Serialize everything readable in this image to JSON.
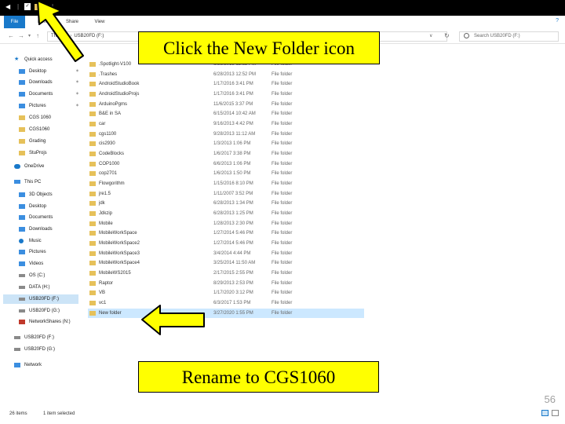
{
  "title_bar": {
    "quick_access_icons": [
      "back-icon",
      "properties-icon",
      "new-folder-icon",
      "dropdown-icon"
    ]
  },
  "ribbon": {
    "tabs": [
      "File",
      "Home",
      "Share",
      "View"
    ],
    "help": "?"
  },
  "address_bar": {
    "path": [
      "This PC",
      "USB20FD (F:)"
    ],
    "search_placeholder": "Search USB20FD (F:)"
  },
  "navigation_pane": {
    "items": [
      {
        "label": "Quick access",
        "icon": "star-icon"
      },
      {
        "label": "Desktop",
        "icon": "desktop-icon",
        "pinned": true
      },
      {
        "label": "Downloads",
        "icon": "downloads-icon",
        "pinned": true
      },
      {
        "label": "Documents",
        "icon": "documents-icon",
        "pinned": true
      },
      {
        "label": "Pictures",
        "icon": "pictures-icon",
        "pinned": true
      },
      {
        "label": "CGS 1060",
        "icon": "folder-icon"
      },
      {
        "label": "CGS1060",
        "icon": "folder-icon"
      },
      {
        "label": "Grading",
        "icon": "folder-icon"
      },
      {
        "label": "StuProjs",
        "icon": "folder-icon"
      },
      {
        "label": "OneDrive",
        "icon": "onedrive-icon"
      },
      {
        "label": "This PC",
        "icon": "pc-icon"
      },
      {
        "label": "3D Objects",
        "icon": "3d-objects-icon"
      },
      {
        "label": "Desktop",
        "icon": "desktop-icon"
      },
      {
        "label": "Documents",
        "icon": "documents-icon"
      },
      {
        "label": "Downloads",
        "icon": "downloads-icon"
      },
      {
        "label": "Music",
        "icon": "music-icon"
      },
      {
        "label": "Pictures",
        "icon": "pictures-icon"
      },
      {
        "label": "Videos",
        "icon": "videos-icon"
      },
      {
        "label": "OS (C:)",
        "icon": "drive-icon"
      },
      {
        "label": "DATA (H:)",
        "icon": "drive-icon"
      },
      {
        "label": "USB20FD (F:)",
        "icon": "usb-drive-icon",
        "selected": true
      },
      {
        "label": "USB20FD (G:)",
        "icon": "usb-drive-icon"
      },
      {
        "label": "NetworkShares (N:)",
        "icon": "network-drive-icon"
      },
      {
        "label": "USB20FD (F:)",
        "icon": "usb-drive-icon"
      },
      {
        "label": "USB20FD (G:)",
        "icon": "usb-drive-icon"
      },
      {
        "label": "Network",
        "icon": "network-icon"
      }
    ]
  },
  "files": [
    {
      "name": ".Spotlight-V100",
      "date": "6/28/2013 12:52 PM",
      "type": "File folder"
    },
    {
      "name": ".Trashes",
      "date": "6/28/2013 12:52 PM",
      "type": "File folder"
    },
    {
      "name": "AndroidStudioBook",
      "date": "1/17/2016 3:41 PM",
      "type": "File folder"
    },
    {
      "name": "AndroidStudioProjs",
      "date": "1/17/2016 3:41 PM",
      "type": "File folder"
    },
    {
      "name": "ArduinoPgms",
      "date": "11/6/2015 3:37 PM",
      "type": "File folder"
    },
    {
      "name": "B&E in SA",
      "date": "6/15/2014 10:42 AM",
      "type": "File folder"
    },
    {
      "name": "car",
      "date": "9/16/2013 4:42 PM",
      "type": "File folder"
    },
    {
      "name": "cgs1100",
      "date": "9/28/2013 11:12 AM",
      "type": "File folder"
    },
    {
      "name": "cis2930",
      "date": "1/3/2013 1:06 PM",
      "type": "File folder"
    },
    {
      "name": "CodeBlocks",
      "date": "1/6/2017 3:38 PM",
      "type": "File folder"
    },
    {
      "name": "COP1000",
      "date": "6/6/2013 1:06 PM",
      "type": "File folder"
    },
    {
      "name": "cop2701",
      "date": "1/6/2013 1:50 PM",
      "type": "File folder"
    },
    {
      "name": "Flowgorithm",
      "date": "1/15/2016 8:10 PM",
      "type": "File folder"
    },
    {
      "name": "jre1.5",
      "date": "1/11/2007 3:52 PM",
      "type": "File folder"
    },
    {
      "name": "jdk",
      "date": "6/28/2013 1:34 PM",
      "type": "File folder"
    },
    {
      "name": "Jdkzip",
      "date": "6/28/2013 1:25 PM",
      "type": "File folder"
    },
    {
      "name": "Mobile",
      "date": "1/28/2013 2:30 PM",
      "type": "File folder"
    },
    {
      "name": "MobileWorkSpace",
      "date": "1/27/2014 5:46 PM",
      "type": "File folder"
    },
    {
      "name": "MobileWorkSpace2",
      "date": "1/27/2014 5:46 PM",
      "type": "File folder"
    },
    {
      "name": "MobileWorkSpace3",
      "date": "3/4/2014 4:44 PM",
      "type": "File folder"
    },
    {
      "name": "MobileWorkSpace4",
      "date": "3/25/2014 11:50 AM",
      "type": "File folder"
    },
    {
      "name": "MobileWS2015",
      "date": "2/17/2015 2:55 PM",
      "type": "File folder"
    },
    {
      "name": "Raptor",
      "date": "8/29/2013 2:53 PM",
      "type": "File folder"
    },
    {
      "name": "VB",
      "date": "1/17/2020 3:12 PM",
      "type": "File folder"
    },
    {
      "name": "vc1",
      "date": "6/3/2017 1:53 PM",
      "type": "File folder"
    },
    {
      "name": "New folder",
      "date": "3/27/2020 1:55 PM",
      "type": "File folder",
      "selected": true
    }
  ],
  "status_bar": {
    "item_count": "26 items",
    "selection": "1 item selected"
  },
  "annotations": {
    "top": "Click the New Folder icon",
    "bottom": "Rename to CGS1060",
    "page_number": "56"
  },
  "colors": {
    "callout_fill": "#ffff00",
    "file_tab": "#1979ca",
    "folder_icon": "#e6c15a",
    "selection": "#cce8ff",
    "title_bar": "#000000"
  }
}
